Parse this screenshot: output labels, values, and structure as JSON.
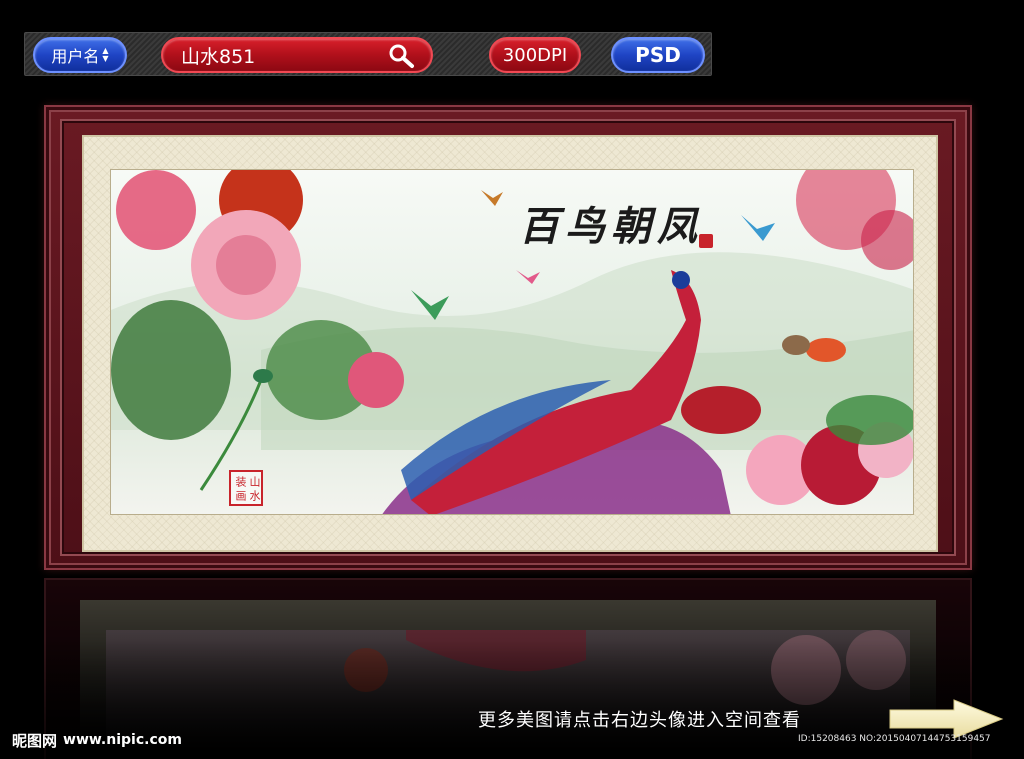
{
  "toolbar": {
    "user_label": "用户名",
    "search_value": "山水851",
    "dpi_label": "300DPI",
    "format_label": "PSD"
  },
  "painting": {
    "title": "百鸟朝凤",
    "seal_chars": [
      "山",
      "水",
      "装",
      "画"
    ]
  },
  "footer": {
    "brand_name": "昵图网",
    "brand_site": "www.nipic.com",
    "promo_text": "更多美图请点击右边头像进入空间查看",
    "image_id": "ID:15208463 NO:20150407144753159457"
  },
  "colors": {
    "frame": "#5a1219",
    "mat": "#eee8d3",
    "toolbar_blue": "#1f44c4",
    "toolbar_red": "#b0101b"
  },
  "icons": [
    "search-icon",
    "sort-arrows-icon",
    "next-arrow-icon"
  ]
}
